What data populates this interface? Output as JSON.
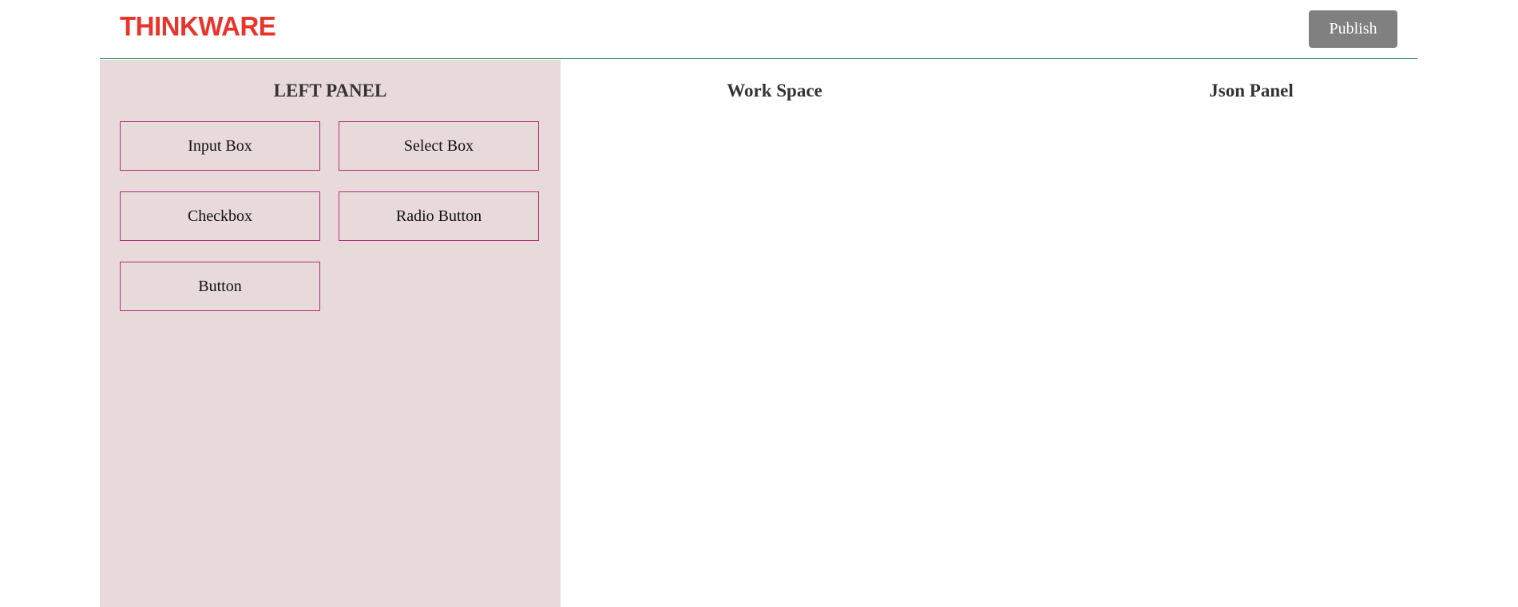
{
  "header": {
    "logo_text": "THINKWARE",
    "publish_label": "Publish"
  },
  "left_panel": {
    "title": "LEFT PANEL",
    "tools": [
      {
        "label": "Input Box"
      },
      {
        "label": "Select Box"
      },
      {
        "label": "Checkbox"
      },
      {
        "label": "Radio Button"
      },
      {
        "label": "Button"
      }
    ]
  },
  "workspace": {
    "title": "Work Space"
  },
  "json_panel": {
    "title": "Json Panel"
  },
  "colors": {
    "logo": "#e8352c",
    "publish_bg": "#808080",
    "left_panel_bg": "#e8d9da",
    "tool_border": "#b0317a",
    "header_divider": "#2e8b57"
  }
}
